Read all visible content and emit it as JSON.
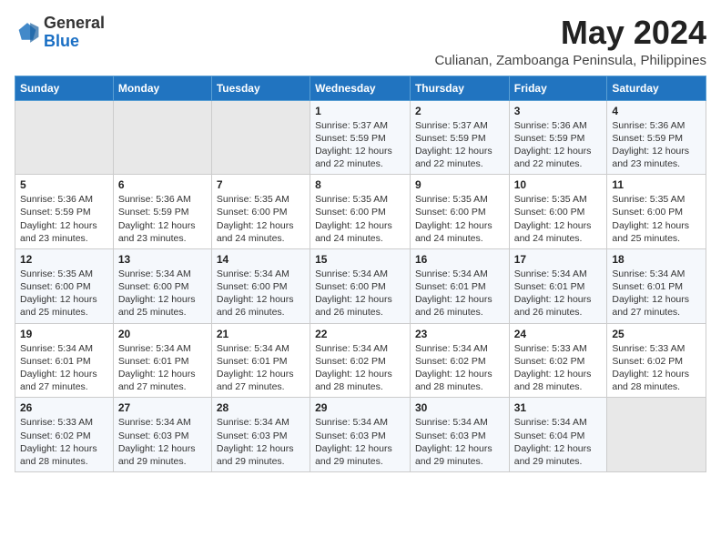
{
  "header": {
    "logo_general": "General",
    "logo_blue": "Blue",
    "month_year": "May 2024",
    "location": "Culianan, Zamboanga Peninsula, Philippines"
  },
  "days_of_week": [
    "Sunday",
    "Monday",
    "Tuesday",
    "Wednesday",
    "Thursday",
    "Friday",
    "Saturday"
  ],
  "weeks": [
    [
      {
        "day": "",
        "empty": true
      },
      {
        "day": "",
        "empty": true
      },
      {
        "day": "",
        "empty": true
      },
      {
        "day": "1",
        "sunrise": "5:37 AM",
        "sunset": "5:59 PM",
        "daylight": "12 hours and 22 minutes."
      },
      {
        "day": "2",
        "sunrise": "5:37 AM",
        "sunset": "5:59 PM",
        "daylight": "12 hours and 22 minutes."
      },
      {
        "day": "3",
        "sunrise": "5:36 AM",
        "sunset": "5:59 PM",
        "daylight": "12 hours and 22 minutes."
      },
      {
        "day": "4",
        "sunrise": "5:36 AM",
        "sunset": "5:59 PM",
        "daylight": "12 hours and 23 minutes."
      }
    ],
    [
      {
        "day": "5",
        "sunrise": "5:36 AM",
        "sunset": "5:59 PM",
        "daylight": "12 hours and 23 minutes."
      },
      {
        "day": "6",
        "sunrise": "5:36 AM",
        "sunset": "5:59 PM",
        "daylight": "12 hours and 23 minutes."
      },
      {
        "day": "7",
        "sunrise": "5:35 AM",
        "sunset": "6:00 PM",
        "daylight": "12 hours and 24 minutes."
      },
      {
        "day": "8",
        "sunrise": "5:35 AM",
        "sunset": "6:00 PM",
        "daylight": "12 hours and 24 minutes."
      },
      {
        "day": "9",
        "sunrise": "5:35 AM",
        "sunset": "6:00 PM",
        "daylight": "12 hours and 24 minutes."
      },
      {
        "day": "10",
        "sunrise": "5:35 AM",
        "sunset": "6:00 PM",
        "daylight": "12 hours and 24 minutes."
      },
      {
        "day": "11",
        "sunrise": "5:35 AM",
        "sunset": "6:00 PM",
        "daylight": "12 hours and 25 minutes."
      }
    ],
    [
      {
        "day": "12",
        "sunrise": "5:35 AM",
        "sunset": "6:00 PM",
        "daylight": "12 hours and 25 minutes."
      },
      {
        "day": "13",
        "sunrise": "5:34 AM",
        "sunset": "6:00 PM",
        "daylight": "12 hours and 25 minutes."
      },
      {
        "day": "14",
        "sunrise": "5:34 AM",
        "sunset": "6:00 PM",
        "daylight": "12 hours and 26 minutes."
      },
      {
        "day": "15",
        "sunrise": "5:34 AM",
        "sunset": "6:00 PM",
        "daylight": "12 hours and 26 minutes."
      },
      {
        "day": "16",
        "sunrise": "5:34 AM",
        "sunset": "6:01 PM",
        "daylight": "12 hours and 26 minutes."
      },
      {
        "day": "17",
        "sunrise": "5:34 AM",
        "sunset": "6:01 PM",
        "daylight": "12 hours and 26 minutes."
      },
      {
        "day": "18",
        "sunrise": "5:34 AM",
        "sunset": "6:01 PM",
        "daylight": "12 hours and 27 minutes."
      }
    ],
    [
      {
        "day": "19",
        "sunrise": "5:34 AM",
        "sunset": "6:01 PM",
        "daylight": "12 hours and 27 minutes."
      },
      {
        "day": "20",
        "sunrise": "5:34 AM",
        "sunset": "6:01 PM",
        "daylight": "12 hours and 27 minutes."
      },
      {
        "day": "21",
        "sunrise": "5:34 AM",
        "sunset": "6:01 PM",
        "daylight": "12 hours and 27 minutes."
      },
      {
        "day": "22",
        "sunrise": "5:34 AM",
        "sunset": "6:02 PM",
        "daylight": "12 hours and 28 minutes."
      },
      {
        "day": "23",
        "sunrise": "5:34 AM",
        "sunset": "6:02 PM",
        "daylight": "12 hours and 28 minutes."
      },
      {
        "day": "24",
        "sunrise": "5:33 AM",
        "sunset": "6:02 PM",
        "daylight": "12 hours and 28 minutes."
      },
      {
        "day": "25",
        "sunrise": "5:33 AM",
        "sunset": "6:02 PM",
        "daylight": "12 hours and 28 minutes."
      }
    ],
    [
      {
        "day": "26",
        "sunrise": "5:33 AM",
        "sunset": "6:02 PM",
        "daylight": "12 hours and 28 minutes."
      },
      {
        "day": "27",
        "sunrise": "5:34 AM",
        "sunset": "6:03 PM",
        "daylight": "12 hours and 29 minutes."
      },
      {
        "day": "28",
        "sunrise": "5:34 AM",
        "sunset": "6:03 PM",
        "daylight": "12 hours and 29 minutes."
      },
      {
        "day": "29",
        "sunrise": "5:34 AM",
        "sunset": "6:03 PM",
        "daylight": "12 hours and 29 minutes."
      },
      {
        "day": "30",
        "sunrise": "5:34 AM",
        "sunset": "6:03 PM",
        "daylight": "12 hours and 29 minutes."
      },
      {
        "day": "31",
        "sunrise": "5:34 AM",
        "sunset": "6:04 PM",
        "daylight": "12 hours and 29 minutes."
      },
      {
        "day": "",
        "empty": true
      }
    ]
  ],
  "labels": {
    "sunrise_prefix": "Sunrise: ",
    "sunset_prefix": "Sunset: ",
    "daylight_prefix": "Daylight: "
  }
}
